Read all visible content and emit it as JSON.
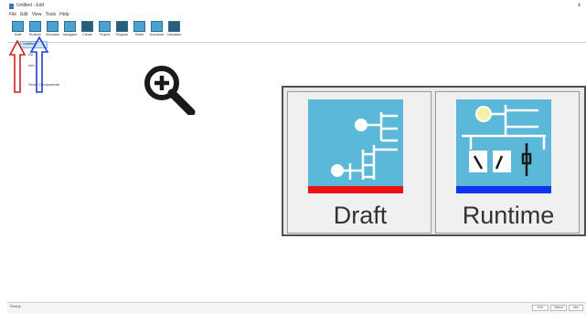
{
  "window": {
    "title": "Untitled - Edit",
    "close_glyph": "x"
  },
  "menu": [
    "File",
    "Edit",
    "View",
    "Tools",
    "Help"
  ],
  "toolbar": [
    {
      "label": "Draft",
      "icon": "draft-icon"
    },
    {
      "label": "Runtime",
      "icon": "runtime-icon"
    },
    {
      "label": "Simulator",
      "icon": "simulator-icon"
    },
    {
      "label": "Navigator",
      "icon": "navigator-icon"
    },
    {
      "label": "Create",
      "icon": "create-icon"
    },
    {
      "label": "Project",
      "icon": "project-icon"
    },
    {
      "label": "Program",
      "icon": "program-icon"
    },
    {
      "label": "Reset",
      "icon": "reset-icon"
    },
    {
      "label": "Download",
      "icon": "download-icon"
    },
    {
      "label": "Calculator",
      "icon": "calculator-icon"
    }
  ],
  "tree": {
    "root": "Untitled",
    "items": [
      "Do",
      "Info",
      "Show Components"
    ]
  },
  "big_buttons": {
    "draft": {
      "label": "Draft",
      "accent": "#ee1111"
    },
    "runtime": {
      "label": "Runtime",
      "accent": "#1133ee"
    }
  },
  "colors": {
    "tile": "#5cb8d8",
    "arrow_red": "#d21f1f",
    "arrow_blue": "#1f3fd2"
  },
  "statusbar": {
    "text": "Ready",
    "panes": [
      "Edit",
      "Select",
      "Idle"
    ]
  }
}
